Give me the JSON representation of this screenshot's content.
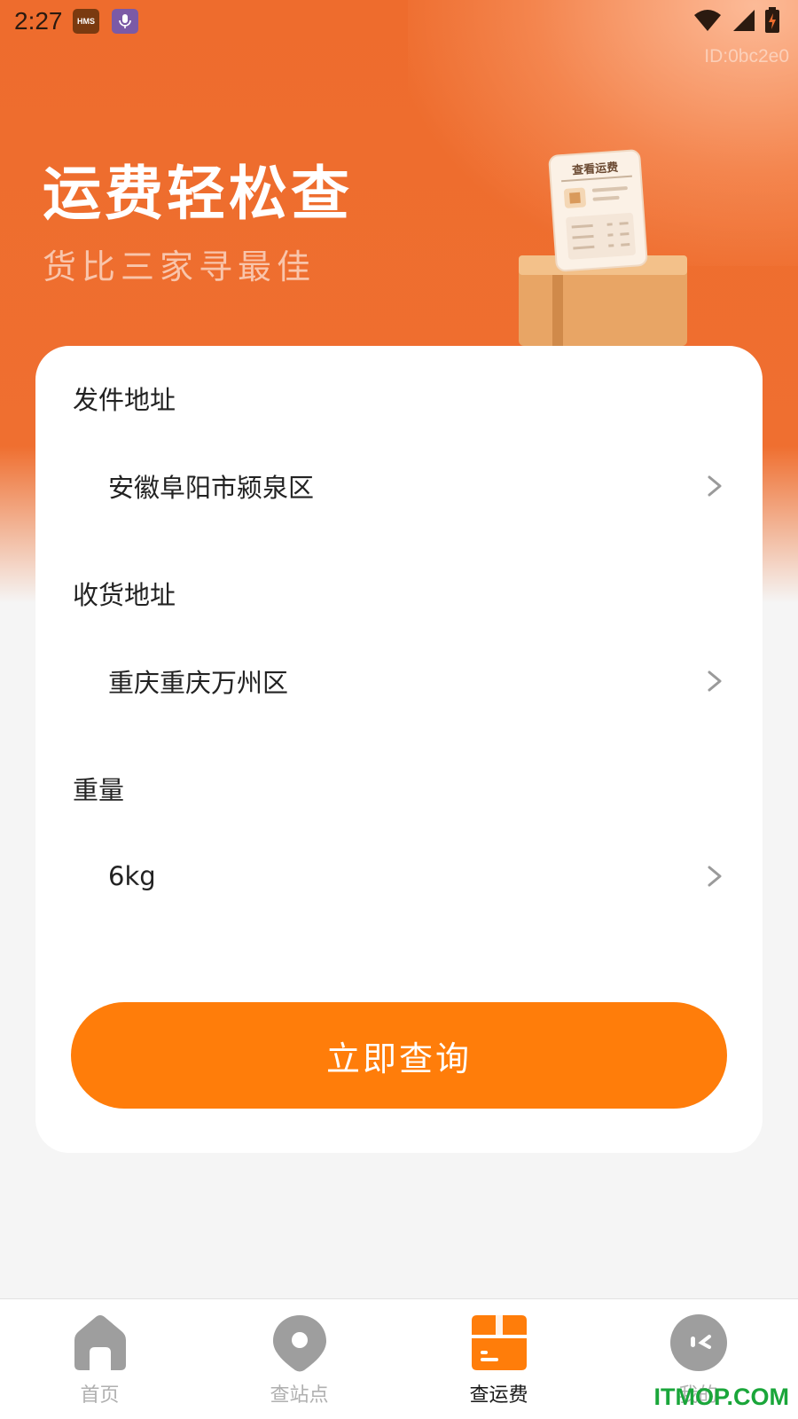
{
  "status_bar": {
    "time": "2:27",
    "hms_badge": "HMS",
    "device_id": "ID:0bc2e0"
  },
  "hero": {
    "title": "运费轻松查",
    "subtitle": "货比三家寻最佳",
    "illustration_caption": "查看运费"
  },
  "form": {
    "sender": {
      "label": "发件地址",
      "value": "安徽阜阳市颍泉区"
    },
    "receiver": {
      "label": "收货地址",
      "value": "重庆重庆万州区"
    },
    "weight": {
      "label": "重量",
      "value": "6kg"
    },
    "submit_label": "立即查询"
  },
  "tabs": [
    {
      "label": "首页",
      "icon": "home-icon",
      "active": false
    },
    {
      "label": "查站点",
      "icon": "location-pin-icon",
      "active": false
    },
    {
      "label": "查运费",
      "icon": "package-box-icon",
      "active": true
    },
    {
      "label": "我的",
      "icon": "profile-icon",
      "active": false
    }
  ],
  "watermark": "ITMOP.COM",
  "colors": {
    "brand_orange": "#ff7d0a",
    "hero_orange": "#ee6c2d",
    "background": "#f5f5f5",
    "tab_inactive": "#b0b0b0"
  }
}
